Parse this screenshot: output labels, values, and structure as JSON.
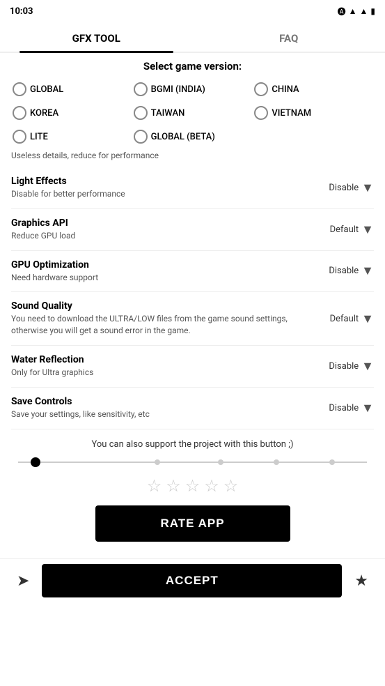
{
  "statusBar": {
    "time": "10:03",
    "icons": [
      "wifi",
      "signal",
      "battery"
    ]
  },
  "tabs": [
    {
      "id": "gfx-tool",
      "label": "GFX TOOL",
      "active": true
    },
    {
      "id": "faq",
      "label": "FAQ",
      "active": false
    }
  ],
  "gameVersion": {
    "sectionTitle": "Select game version:",
    "options": [
      {
        "id": "global",
        "label": "GLOBAL"
      },
      {
        "id": "bgmi",
        "label": "BGMI (INDIA)"
      },
      {
        "id": "china",
        "label": "CHINA"
      },
      {
        "id": "korea",
        "label": "KOREA"
      },
      {
        "id": "taiwan",
        "label": "TAIWAN"
      },
      {
        "id": "vietnam",
        "label": "VIETNAM"
      },
      {
        "id": "lite",
        "label": "LITE"
      },
      {
        "id": "global-beta",
        "label": "GLOBAL (BETA)"
      }
    ],
    "note": "Useless details, reduce for performance"
  },
  "settings": [
    {
      "id": "light-effects",
      "name": "Light Effects",
      "desc": "Disable for better performance",
      "value": "Disable"
    },
    {
      "id": "graphics-api",
      "name": "Graphics API",
      "desc": "Reduce GPU load",
      "value": "Default"
    },
    {
      "id": "gpu-optimization",
      "name": "GPU Optimization",
      "desc": "Need hardware support",
      "value": "Disable"
    },
    {
      "id": "sound-quality",
      "name": "Sound Quality",
      "desc": "You need to download the ULTRA/LOW files from the game sound settings, otherwise you will get a sound error in the game.",
      "value": "Default"
    },
    {
      "id": "water-reflection",
      "name": "Water Reflection",
      "desc": "Only for Ultra graphics",
      "value": "Disable"
    },
    {
      "id": "save-controls",
      "name": "Save Controls",
      "desc": "Save your settings, like sensitivity, etc",
      "value": "Disable"
    }
  ],
  "support": {
    "text": "You can also support the project with this button ;)",
    "sliderDots": [
      40,
      42,
      58,
      74
    ],
    "thumbPosition": 5
  },
  "rating": {
    "stars": 5,
    "rateButtonLabel": "RATE APP"
  },
  "bottomBar": {
    "shareIcon": "➤",
    "acceptLabel": "ACCEPT",
    "starIcon": "★"
  }
}
